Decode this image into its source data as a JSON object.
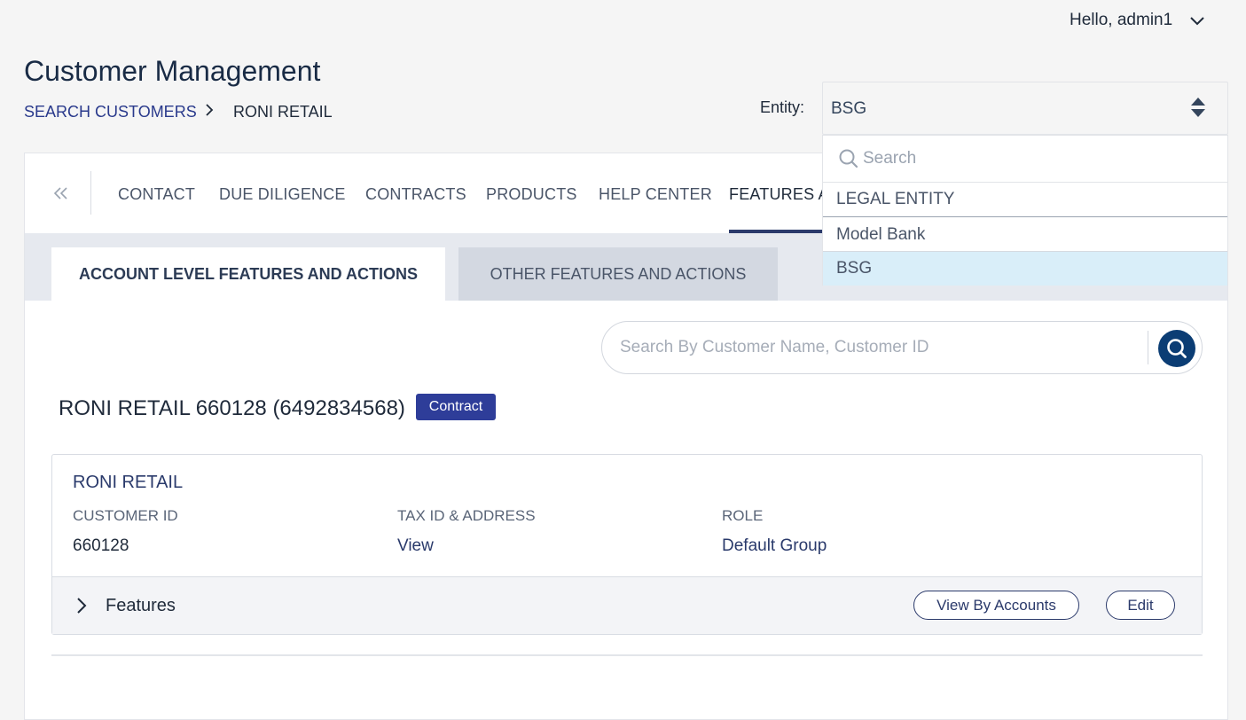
{
  "header": {
    "greeting": "Hello, admin1",
    "title": "Customer Management",
    "breadcrumb": {
      "root": "SEARCH CUSTOMERS",
      "current": "RONI RETAIL"
    },
    "entity": {
      "label": "Entity:",
      "value": "BSG"
    }
  },
  "nav": {
    "tabs": [
      {
        "label": "CONTACT"
      },
      {
        "label": "DUE DILIGENCE"
      },
      {
        "label": "CONTRACTS"
      },
      {
        "label": "PRODUCTS"
      },
      {
        "label": "HELP CENTER"
      },
      {
        "label": "FEATURES AND ACTIONS"
      }
    ]
  },
  "subtabs": {
    "account": "ACCOUNT LEVEL FEATURES AND ACTIONS",
    "other": "OTHER FEATURES AND ACTIONS"
  },
  "search": {
    "placeholder": "Search By Customer Name, Customer ID"
  },
  "customer": {
    "heading": "RONI RETAIL 660128 (6492834568)",
    "badge": "Contract",
    "name": "RONI RETAIL",
    "columns": {
      "customer_id_label": "CUSTOMER ID",
      "customer_id_value": "660128",
      "tax_label": "TAX ID & ADDRESS",
      "tax_value": "View",
      "role_label": "ROLE",
      "role_value": "Default Group"
    },
    "features_label": "Features",
    "view_by_accounts": "View By Accounts",
    "edit": "Edit"
  },
  "entity_dropdown": {
    "search_placeholder": "Search",
    "header": "LEGAL ENTITY",
    "options": [
      {
        "label": "Model Bank"
      },
      {
        "label": "BSG",
        "selected": true
      }
    ]
  },
  "colors": {
    "accent": "#2e3d99",
    "search_button": "#0b3d74",
    "selected_option": "#d9eef9"
  }
}
